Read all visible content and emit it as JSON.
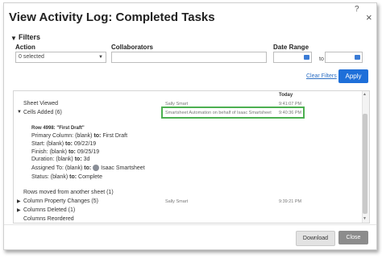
{
  "dialog": {
    "title": "View Activity Log: Completed Tasks",
    "help_glyph": "?",
    "close_glyph": "×"
  },
  "filters": {
    "toggle_glyph": "▼",
    "label": "Filters",
    "action_label": "Action",
    "action_value": "0 selected",
    "collaborators_label": "Collaborators",
    "collaborators_value": "",
    "date_range_label": "Date Range",
    "date_to_label": "to",
    "clear_label": "Clear Filters",
    "apply_label": "Apply"
  },
  "log": {
    "today_header": "Today",
    "rows": [
      {
        "name": "Sheet Viewed",
        "collaborator": "Sally Smart",
        "time": "9:41:07 PM",
        "arrow": ""
      },
      {
        "name": "Cells Added (6)",
        "collaborator": "Smartsheet Automation on behalf of Isaac Smartsheet",
        "time": "9:40:36 PM",
        "arrow": "▼"
      },
      {
        "name": "Column Property Changes (5)",
        "collaborator": "Sally Smart",
        "time": "9:39:21 PM",
        "arrow": "▶"
      },
      {
        "name": "Columns Deleted (1)",
        "collaborator": "",
        "time": "",
        "arrow": "▶"
      },
      {
        "name": "Columns Reordered",
        "collaborator": "",
        "time": "",
        "arrow": ""
      }
    ],
    "detail": {
      "row_title": "Row 4998: \"First Draft\"",
      "primary_column": {
        "label": "Primary Column:",
        "from": "(blank)",
        "to_word": "to:",
        "to": "First Draft"
      },
      "start": {
        "label": "Start:",
        "from": "(blank)",
        "to_word": "to:",
        "to": "09/22/19"
      },
      "finish": {
        "label": "Finish:",
        "from": "(blank)",
        "to_word": "to:",
        "to": "09/25/19"
      },
      "duration": {
        "label": "Duration:",
        "from": "(blank)",
        "to_word": "to:",
        "to": "3d"
      },
      "assigned_to": {
        "label": "Assigned To:",
        "from": "(blank)",
        "to_word": "to:",
        "to": "Isaac Smartsheet"
      },
      "status": {
        "label": "Status:",
        "from": "(blank)",
        "to_word": "to:",
        "to": "Complete"
      },
      "rows_moved": "Rows moved from another sheet (1)"
    }
  },
  "footer": {
    "download_label": "Download",
    "close_label": "Close"
  },
  "colors": {
    "accent": "#1e6fd9",
    "highlight": "#4caf50"
  }
}
